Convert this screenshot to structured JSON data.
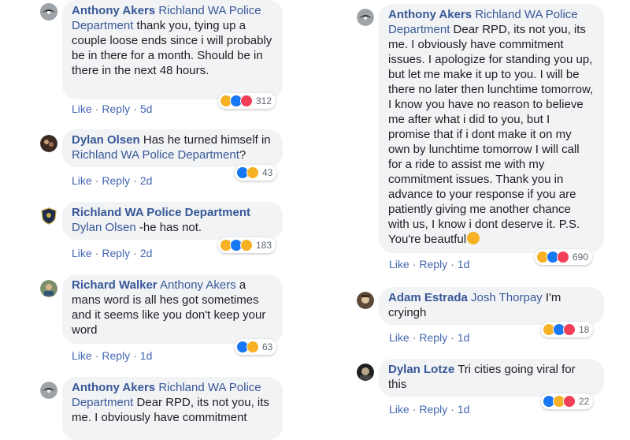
{
  "left_column": [
    {
      "author": "Anthony Akers",
      "tag": "Richland WA Police Department",
      "text": " thank you, tying up a couple loose ends since i will probably be in there for a month. Should be in there in the next 48 hours.",
      "like": "Like",
      "reply": "Reply",
      "time": "5d",
      "reactions": [
        "haha-icon",
        "like-icon",
        "love-icon"
      ],
      "count": "312"
    },
    {
      "author": "Dylan Olsen",
      "pre": " Has he turned himself in ",
      "tag": "Richland WA Police Department",
      "post": "?",
      "like": "Like",
      "reply": "Reply",
      "time": "2d",
      "reactions": [
        "like-icon",
        "haha-icon"
      ],
      "count": "43"
    },
    {
      "author": "Richland WA Police Department",
      "tag": "Dylan Olsen",
      "text": " -he has not.",
      "like": "Like",
      "reply": "Reply",
      "time": "2d",
      "reactions": [
        "haha-icon",
        "like-icon",
        "wow-icon"
      ],
      "count": "183"
    },
    {
      "author": "Richard Walker",
      "tag": "Anthony Akers",
      "text": " a mans word is all hes got sometimes and it seems like you don't keep your word",
      "like": "Like",
      "reply": "Reply",
      "time": "1d",
      "reactions": [
        "like-icon",
        "haha-icon"
      ],
      "count": "63"
    },
    {
      "author": "Anthony Akers",
      "tag": "Richland WA Police Department",
      "text": " Dear RPD, its not you, its me. I obviously have commitment"
    }
  ],
  "right_column": [
    {
      "author": "Anthony Akers",
      "tag": "Richland WA Police Department",
      "text": " Dear RPD, its not you, its me. I obviously have commitment issues. I apologize for standing you up, but let me make it up to you. I will be there no later then lunchtime tomorrow, I know you have no reason to believe me after what i did to you, but I promise that if i dont make it on my own by lunchtime tomorrow I will call for a ride to assist me with my commitment issues. Thank you in advance to your response if you are patiently giving me another chance with us, I know i dont deserve it. P.S. You're beautful",
      "like": "Like",
      "reply": "Reply",
      "time": "1d",
      "reactions": [
        "haha-icon",
        "like-icon",
        "love-icon"
      ],
      "count": "690"
    },
    {
      "author": "Adam Estrada",
      "tag": "Josh Thorpay",
      "text": " I'm cryingh",
      "like": "Like",
      "reply": "Reply",
      "time": "1d",
      "reactions": [
        "haha-icon",
        "like-icon",
        "love-icon"
      ],
      "count": "18"
    },
    {
      "author": "Dylan Lotze",
      "text": " Tri cities going viral for this",
      "like": "Like",
      "reply": "Reply",
      "time": "1d",
      "reactions": [
        "like-icon",
        "haha-icon",
        "love-icon"
      ],
      "count": "22"
    }
  ],
  "colors": {
    "author": "#385898",
    "link": "#4267b2",
    "bubble": "#f2f3f5",
    "meta": "#606770"
  }
}
